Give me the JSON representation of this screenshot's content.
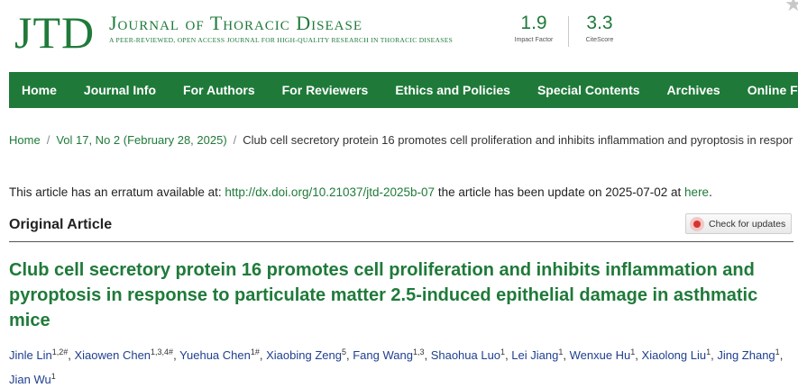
{
  "header": {
    "logo": "JTD",
    "journal_name": "Journal of Thoracic Disease",
    "tagline": "A peer-reviewed, open access journal for high-quality research in thoracic diseases",
    "impact_factor": {
      "value": "1.9",
      "label": "Impact Factor"
    },
    "citescore": {
      "value": "3.3",
      "label": "CiteScore"
    }
  },
  "nav": {
    "items": [
      {
        "label": "Home"
      },
      {
        "label": "Journal Info"
      },
      {
        "label": "For Authors"
      },
      {
        "label": "For Reviewers"
      },
      {
        "label": "Ethics and Policies"
      },
      {
        "label": "Special Contents"
      },
      {
        "label": "Archives"
      },
      {
        "label": "Online First"
      }
    ]
  },
  "breadcrumb": {
    "home": "Home",
    "issue": "Vol 17, No 2 (February 28, 2025)",
    "current": "Club cell secretory protein 16 promotes cell proliferation and inhibits inflammation and pyroptosis in respor"
  },
  "erratum": {
    "prefix": "This article has an erratum available at:",
    "doi_link": "http://dx.doi.org/10.21037/jtd-2025b-07",
    "middle": "the article has been update on 2025-07-02 at",
    "here_link": "here",
    "suffix": "."
  },
  "article": {
    "type": "Original Article",
    "check_updates_label": "Check for updates",
    "title": "Club cell secretory protein 16 promotes cell proliferation and inhibits inflammation and pyroptosis in response to particulate matter 2.5-induced epithelial damage in asthmatic mice",
    "authors": [
      {
        "name": "Jinle Lin",
        "sup": "1,2#"
      },
      {
        "name": "Xiaowen Chen",
        "sup": "1,3,4#"
      },
      {
        "name": "Yuehua Chen",
        "sup": "1#"
      },
      {
        "name": "Xiaobing Zeng",
        "sup": "5"
      },
      {
        "name": "Fang Wang",
        "sup": "1,3"
      },
      {
        "name": "Shaohua Luo",
        "sup": "1"
      },
      {
        "name": "Lei Jiang",
        "sup": "1"
      },
      {
        "name": "Wenxue Hu",
        "sup": "1"
      },
      {
        "name": "Xiaolong Liu",
        "sup": "1"
      },
      {
        "name": "Jing Zhang",
        "sup": "1"
      },
      {
        "name": "Jian Wu",
        "sup": "1"
      }
    ]
  },
  "colors": {
    "brand_green": "#1f7a3a",
    "author_blue": "#1f3f8f"
  }
}
